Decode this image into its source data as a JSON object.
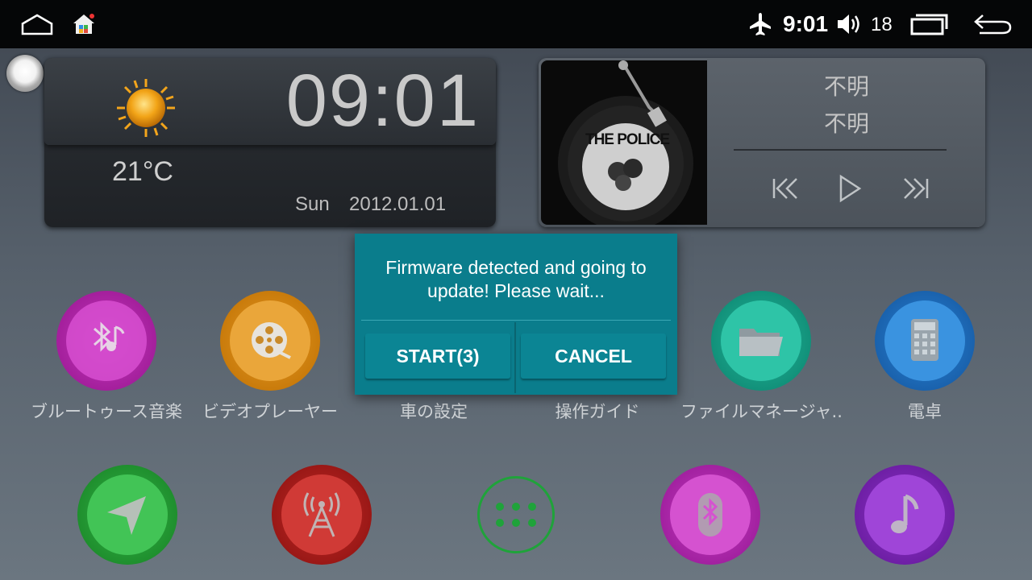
{
  "status_bar": {
    "time": "9:01",
    "volume_level": "18",
    "icons": [
      "home-outline-icon",
      "app-store-icon",
      "airplane-icon",
      "volume-icon",
      "recent-apps-icon",
      "back-icon"
    ]
  },
  "clock_widget": {
    "time": "09:01",
    "temperature": "21°C",
    "weekday": "Sun",
    "date": "2012.01.01",
    "weather_icon": "sun-icon"
  },
  "music_widget": {
    "album_text": "THE POLICE",
    "title": "不明",
    "artist": "不明",
    "controls": [
      "previous-icon",
      "play-icon",
      "next-icon"
    ]
  },
  "apps_row1": [
    {
      "label": "ブルートゥース音楽",
      "icon": "bluetooth-music-icon",
      "color": "#c02bb8"
    },
    {
      "label": "ビデオプレーヤー",
      "icon": "film-reel-icon",
      "color": "#d98a12"
    },
    {
      "label": "車の設定",
      "icon": "car-settings-icon",
      "color": "#2a9d8f"
    },
    {
      "label": "操作ガイド",
      "icon": "guide-icon",
      "color": "#3b7dd8"
    },
    {
      "label": "ファイルマネージャ..",
      "icon": "folder-icon",
      "color": "#18a88e"
    },
    {
      "label": "電卓",
      "icon": "calculator-icon",
      "color": "#1f74c9"
    }
  ],
  "apps_row2": [
    {
      "icon": "navigation-icon",
      "color": "#27a83a"
    },
    {
      "icon": "radio-tower-icon",
      "color": "#b3201e"
    },
    {
      "icon": "app-drawer-icon",
      "color": "#1fa33a"
    },
    {
      "icon": "bluetooth-icon",
      "color": "#c22bc0"
    },
    {
      "icon": "music-note-icon",
      "color": "#8a2bd0"
    }
  ],
  "dialog": {
    "message_line1": "Firmware detected and going to",
    "message_line2": "update! Please wait...",
    "start_label": "START(3)",
    "cancel_label": "CANCEL"
  }
}
